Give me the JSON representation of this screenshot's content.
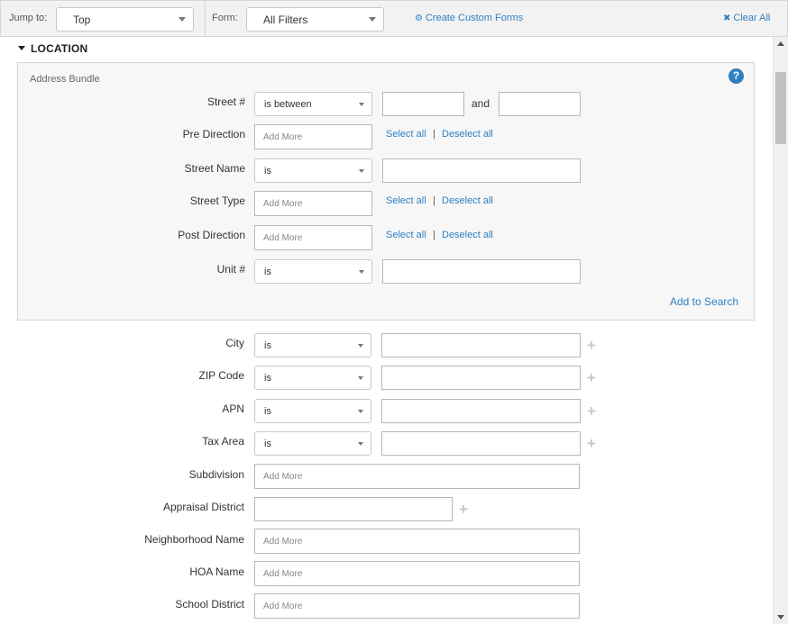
{
  "toolbar": {
    "jump_label": "Jump to:",
    "jump_value": "Top",
    "form_label": "Form:",
    "form_value": "All Filters",
    "create_forms": "Create Custom Forms",
    "clear_all": "Clear All"
  },
  "section": {
    "title": "LOCATION"
  },
  "bundle": {
    "title": "Address Bundle",
    "help": "?",
    "street_num": {
      "label": "Street #",
      "op": "is between",
      "and": "and"
    },
    "pre_direction": {
      "label": "Pre Direction",
      "placeholder": "Add More",
      "select_all": "Select all",
      "sep": "|",
      "deselect_all": "Deselect all"
    },
    "street_name": {
      "label": "Street Name",
      "op": "is"
    },
    "street_type": {
      "label": "Street Type",
      "placeholder": "Add More",
      "select_all": "Select all",
      "sep": "|",
      "deselect_all": "Deselect all"
    },
    "post_direction": {
      "label": "Post Direction",
      "placeholder": "Add More",
      "select_all": "Select all",
      "sep": "|",
      "deselect_all": "Deselect all"
    },
    "unit_num": {
      "label": "Unit #",
      "op": "is"
    },
    "add_to_search": "Add to Search"
  },
  "fields": {
    "city": {
      "label": "City",
      "op": "is"
    },
    "zip": {
      "label": "ZIP Code",
      "op": "is"
    },
    "apn": {
      "label": "APN",
      "op": "is"
    },
    "tax_area": {
      "label": "Tax Area",
      "op": "is"
    },
    "subdivision": {
      "label": "Subdivision",
      "placeholder": "Add More"
    },
    "appraisal_district": {
      "label": "Appraisal District"
    },
    "neighborhood": {
      "label": "Neighborhood Name",
      "placeholder": "Add More"
    },
    "hoa": {
      "label": "HOA Name",
      "placeholder": "Add More"
    },
    "school_district": {
      "label": "School District",
      "placeholder": "Add More"
    }
  },
  "icons": {
    "gear": "gear-icon",
    "close": "close-icon",
    "plus": "plus-icon"
  },
  "colors": {
    "link": "#2e7fc1",
    "toolbar_bg": "#f2f2f2",
    "bundle_bg": "#f7f7f7"
  }
}
